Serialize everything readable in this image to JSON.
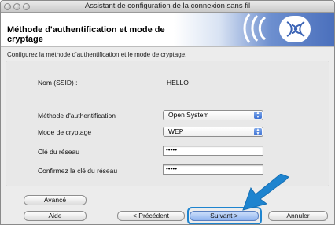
{
  "window": {
    "title": "Assistant de configuration de la connexion sans fil"
  },
  "header": {
    "title_line1": "Méthode d'authentification et mode de",
    "title_line2": "cryptage"
  },
  "instruction": "Configurez la méthode d'authentification et le mode de cryptage.",
  "form": {
    "ssid_label": "Nom (SSID) :",
    "ssid_value": "HELLO",
    "auth_label": "Méthode d'authentification",
    "auth_value": "Open System",
    "crypt_label": "Mode de cryptage",
    "crypt_value": "WEP",
    "key_label": "Clé du réseau",
    "key_value": "•••••",
    "confirm_label": "Confirmez la clé du réseau",
    "confirm_value": "•••••"
  },
  "buttons": {
    "advanced": "Avancé",
    "help": "Aide",
    "previous": "< Précédent",
    "next": "Suivant >",
    "cancel": "Annuler"
  },
  "colors": {
    "accent": "#1e84cf",
    "default_button": "#8fb3ee"
  }
}
